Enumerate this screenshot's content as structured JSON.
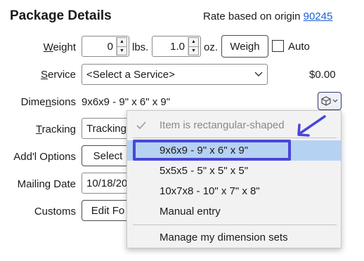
{
  "header": {
    "title": "Package Details",
    "rate_text": "Rate based on origin",
    "origin_zip": "90245"
  },
  "weight": {
    "label_pre": "",
    "label_ul": "W",
    "label_post": "eight",
    "lbs_value": "0",
    "lbs_unit": "lbs.",
    "oz_value": "1.0",
    "oz_unit": "oz.",
    "weigh_button": "Weigh",
    "auto_label": "Auto"
  },
  "service": {
    "label_pre": "",
    "label_ul": "S",
    "label_post": "ervice",
    "selected": "<Select a Service>",
    "price": "$0.00"
  },
  "dimensions": {
    "label_pre": "Dime",
    "label_ul": "n",
    "label_post": "sions",
    "value": "9x6x9 - 9\" x 6\" x 9\""
  },
  "tracking": {
    "label_pre": "",
    "label_ul": "T",
    "label_post": "racking",
    "value": "Tracking"
  },
  "addl_options": {
    "label": "Add'l Options",
    "button": "Select"
  },
  "mailing_date": {
    "label": "Mailing Date",
    "value": "10/18/20"
  },
  "customs": {
    "label": "Customs",
    "button": "Edit Fo"
  },
  "dimension_menu": {
    "items": [
      {
        "label": "Item is rectangular-shaped",
        "checked": true,
        "disabled": true
      },
      {
        "label": "9x6x9 - 9\" x 6\" x 9\"",
        "selected": true
      },
      {
        "label": "5x5x5 - 5\" x 5\" x 5\""
      },
      {
        "label": "10x7x8 - 10\" x 7\" x 8\""
      },
      {
        "label": "Manual entry"
      },
      {
        "label": "Manage my dimension sets"
      }
    ]
  },
  "colors": {
    "link": "#1a5fd6",
    "annotation": "#4a46d8",
    "selected_row": "#b6d2f2"
  }
}
